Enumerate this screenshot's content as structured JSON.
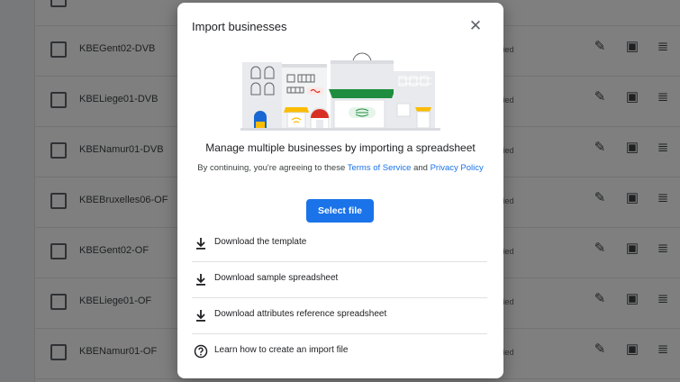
{
  "background_rows": [
    {
      "name": "KBEGent02-DVB",
      "status": "fied"
    },
    {
      "name": "KBELiege01-DVB",
      "status": "fied"
    },
    {
      "name": "KBENamur01-DVB",
      "status": "fied"
    },
    {
      "name": "KBEBruxelles06-OF",
      "status": "fied"
    },
    {
      "name": "KBEGent02-OF",
      "status": "fied"
    },
    {
      "name": "KBELiege01-OF",
      "status": "fied"
    },
    {
      "name": "KBENamur01-OF",
      "status": "fied"
    }
  ],
  "dialog": {
    "title": "Import businesses",
    "close_icon": "close-icon",
    "headline": "Manage multiple businesses by importing a spreadsheet",
    "terms_prefix": "By continuing, you're agreeing to these ",
    "terms_link": "Terms of Service",
    "terms_and": " and ",
    "privacy_link": "Privacy Policy",
    "select_button": "Select file",
    "options": [
      {
        "icon": "download-icon",
        "label": "Download the template"
      },
      {
        "icon": "download-icon",
        "label": "Download sample spreadsheet"
      },
      {
        "icon": "download-icon",
        "label": "Download attributes reference spreadsheet"
      },
      {
        "icon": "help-circle-icon",
        "label": "Learn how to create an import file"
      }
    ]
  },
  "colors": {
    "accent": "#1a73e8",
    "shop_green": "#1e8e3e",
    "shop_red": "#d93025",
    "shop_blue": "#1967d2",
    "shop_yellow": "#fbbc04"
  }
}
